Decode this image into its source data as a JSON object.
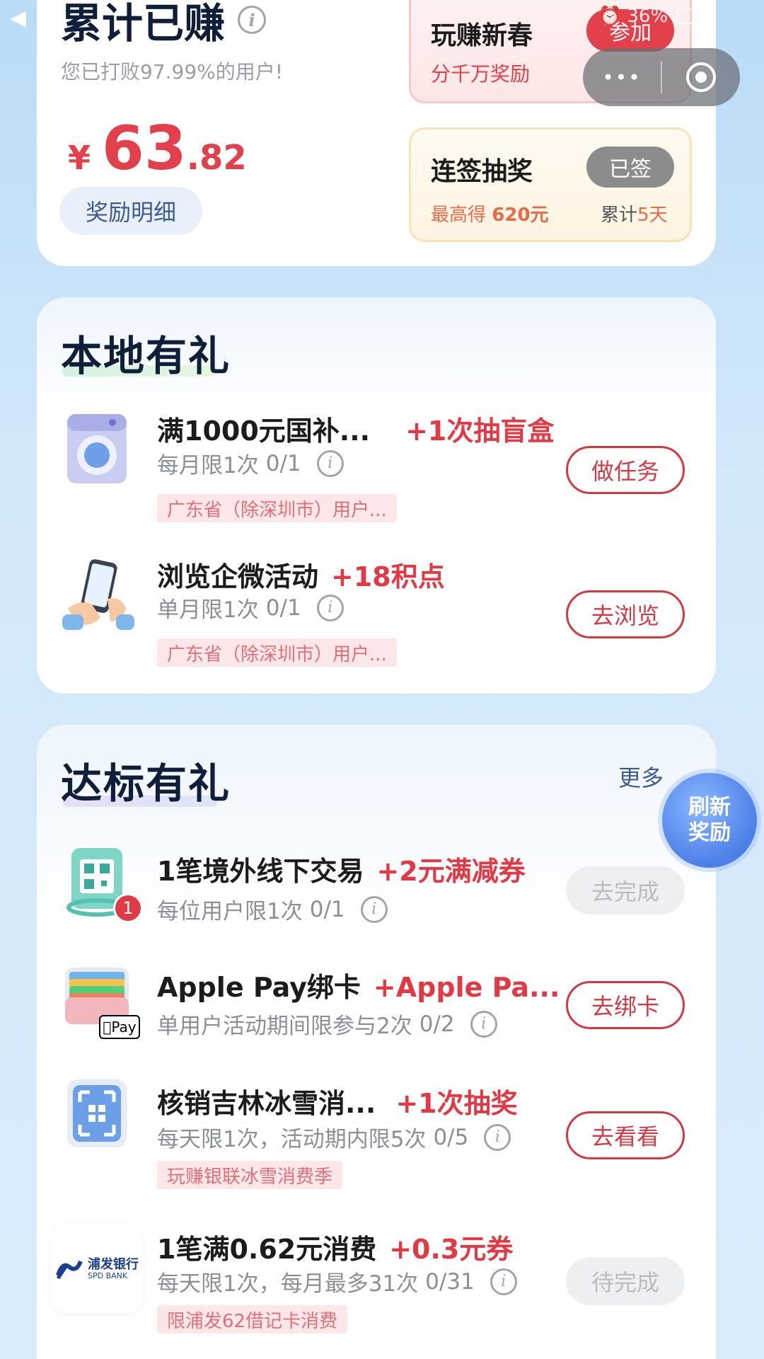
{
  "status_bar": {
    "back_glyph": "◀",
    "battery_text": "36%"
  },
  "mini_program_capsule": {
    "more_glyph": "•••",
    "close_glyph": "⊗"
  },
  "earnings": {
    "title": "累计已赚",
    "beat_text": "您已打败97.99%的用户!",
    "currency": "¥",
    "amount_int": "63",
    "amount_dec": ".82",
    "details_button": "奖励明细"
  },
  "promo_spring": {
    "title": "玩赚新春",
    "subtitle": "分千万奖励",
    "button": "参加"
  },
  "promo_signin": {
    "title": "连签抽奖",
    "button": "已签",
    "max_prefix": "最高得 ",
    "max_amount": "620元",
    "streak_prefix": "累计",
    "streak_days": "5天"
  },
  "local_section": {
    "title": "本地有礼",
    "items": [
      {
        "title": "满1000元国补...",
        "reward": "+1次抽盲盒",
        "limit": "每月限1次",
        "progress": "0/1",
        "tag": "广东省（除深圳市）用户...",
        "button": "做任务",
        "icon": "washing-machine-icon"
      },
      {
        "title": "浏览企微活动",
        "reward": "+18积点",
        "limit": "单月限1次",
        "progress": "0/1",
        "tag": "广东省（除深圳市）用户...",
        "button": "去浏览",
        "icon": "phone-hand-icon"
      }
    ]
  },
  "target_section": {
    "title": "达标有礼",
    "more_link": "更多",
    "refresh_badge": [
      "刷新",
      "奖励"
    ],
    "items": [
      {
        "title": "1笔境外线下交易",
        "reward": "+2元满减券",
        "limit": "每位用户限1次",
        "progress": "0/1",
        "button": "去完成",
        "icon": "qr-code-icon",
        "badge": "1"
      },
      {
        "title": "Apple Pay绑卡",
        "reward": "+Apple Pa...",
        "limit": "单用户活动期间限参与2次",
        "progress": "0/2",
        "button": "去绑卡",
        "icon": "wallet-icon",
        "pay_label": "Pay"
      },
      {
        "title": "核销吉林冰雪消...",
        "reward": "+1次抽奖",
        "limit": "每天限1次，活动期内限5次",
        "progress": "0/5",
        "tag": "玩赚银联冰雪消费季",
        "button": "去看看",
        "icon": "scan-icon"
      },
      {
        "title": "1笔满0.62元消费",
        "reward": "+0.3元券",
        "limit": "每天限1次，每月最多31次",
        "progress": "0/31",
        "tag": "限浦发62借记卡消费",
        "button": "待完成",
        "icon": "spd-bank-logo",
        "bank_name": "浦发银行",
        "bank_en": "SPD BANK"
      }
    ]
  },
  "colors": {
    "accent_red": "#e23a45",
    "title_navy": "#0f1f3a",
    "bg_blue": "#c8e2f8"
  }
}
